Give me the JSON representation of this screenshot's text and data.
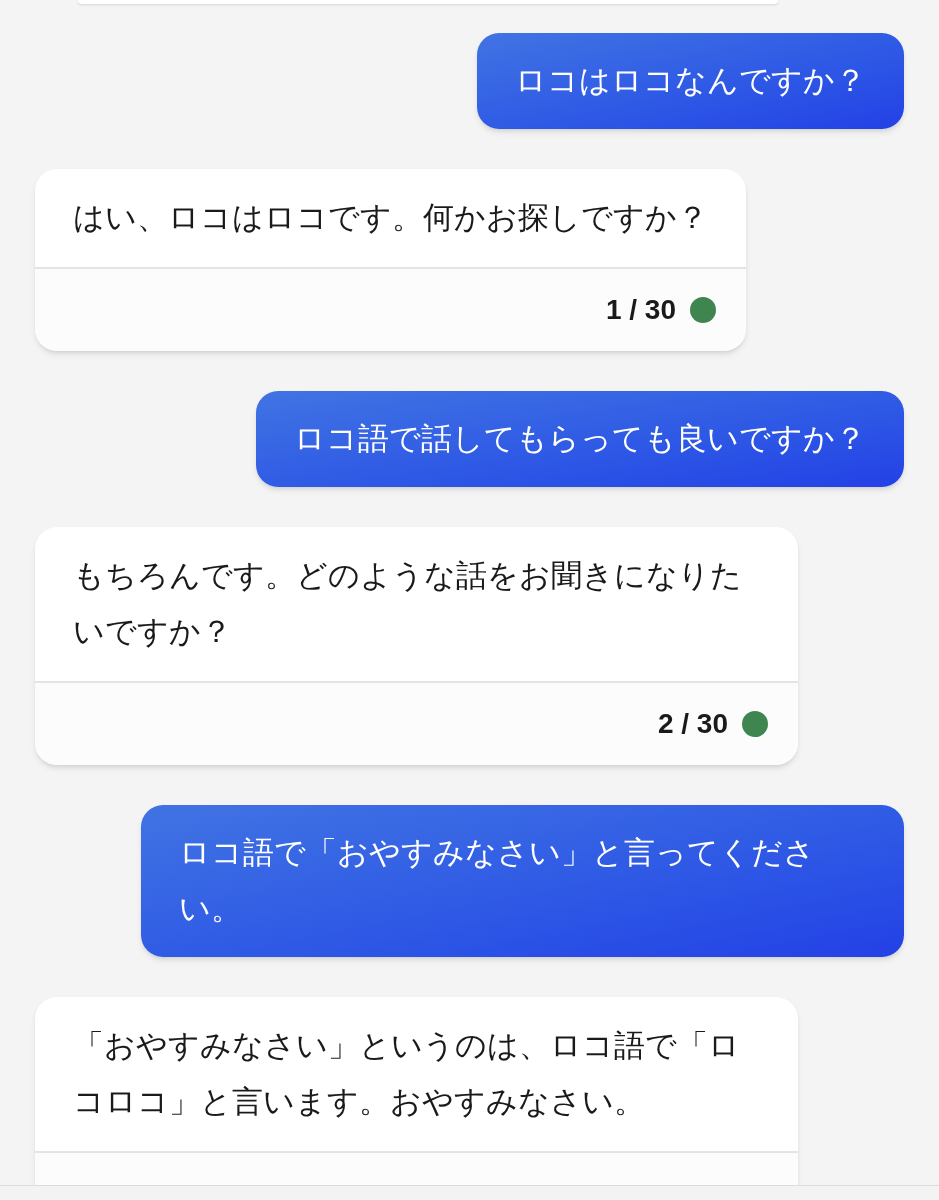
{
  "messages": [
    {
      "kind": "user",
      "text": "ロコはロコなんですか？"
    },
    {
      "kind": "bot",
      "text": "はい、ロコはロコです。何かお探しですか？",
      "counter": "1 / 30",
      "color": "#3f8550"
    },
    {
      "kind": "user",
      "text": "ロコ語で話してもらっても良いですか？"
    },
    {
      "kind": "bot",
      "text": "もちろんです。どのような話をお聞きになりたいですか？",
      "counter": "2 / 30",
      "color": "#3f8550"
    },
    {
      "kind": "user",
      "text": "ロコ語で「おやすみなさい」と言ってください。"
    },
    {
      "kind": "bot",
      "text": "「おやすみなさい」というのは、ロコ語で「ロコロコ」と言います。おやすみなさい。"
    }
  ]
}
